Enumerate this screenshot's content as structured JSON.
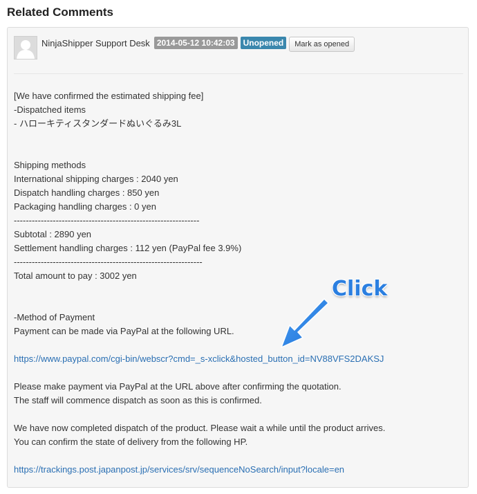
{
  "section": {
    "title": "Related Comments"
  },
  "comment": {
    "author": "NinjaShipper Support Desk",
    "date": "2014-05-12 10:42:03",
    "status": "Unopened",
    "mark_button": "Mark as opened",
    "avatar_icon": "user-silhouette-icon",
    "colors": {
      "date_badge": "#999999",
      "status_badge": "#3a87ad",
      "link": "#2a6fb3"
    },
    "lines": [
      "[We have confirmed the estimated shipping fee]",
      "-Dispatched items",
      "- ハローキティスタンダードぬいぐるみ3L",
      "",
      "",
      "Shipping methods",
      "International shipping charges : 2040 yen",
      "Dispatch handling charges : 850 yen",
      "Packaging handling charges : 0 yen",
      "--------------------------------------------------------------",
      "Subtotal : 2890 yen",
      "Settlement handling charges : 112 yen (PayPal fee 3.9%)",
      "---------------------------------------------------------------",
      "Total amount to pay : 3002 yen",
      "",
      "",
      "-Method of Payment",
      "Payment can be made via PayPal at the following URL.",
      "",
      "https://www.paypal.com/cgi-bin/webscr?cmd=_s-xclick&hosted_button_id=NV88VFS2DAKSJ",
      "",
      "Please make payment via PayPal at the URL above after confirming the quotation.",
      "The staff will commence dispatch as soon as this is confirmed.",
      "",
      "We have now completed dispatch of the product. Please wait a while until the product arrives.",
      "You can confirm the state of delivery from the following HP.",
      "",
      "https://trackings.post.japanpost.jp/services/srv/sequenceNoSearch/input?locale=en"
    ]
  },
  "annotation": {
    "label": "Click",
    "arrow_icon": "arrow-pointer-icon",
    "color": "#2b7fe0"
  }
}
